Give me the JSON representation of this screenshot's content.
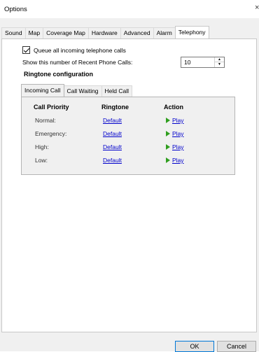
{
  "window": {
    "title": "Options",
    "close_glyph": "×"
  },
  "tabs": [
    "Sound",
    "Map",
    "Coverage Map",
    "Hardware",
    "Advanced",
    "Alarm",
    "Telephony"
  ],
  "active_tab": "Telephony",
  "queue_calls": {
    "label": "Queue all incoming telephone calls",
    "checked": true
  },
  "recent_calls": {
    "label": "Show this number of Recent Phone Calls:",
    "value": "10"
  },
  "ringtone_config": {
    "title": "Ringtone configuration"
  },
  "sub_tabs": [
    "Incoming Call",
    "Call Waiting",
    "Held Call"
  ],
  "active_sub_tab": "Incoming Call",
  "table": {
    "headers": {
      "priority": "Call Priority",
      "ringtone": "Ringtone",
      "action": "Action"
    },
    "rows": [
      {
        "priority": "Normal:",
        "ringtone": "Default",
        "action": "Play"
      },
      {
        "priority": "Emergency:",
        "ringtone": "Default",
        "action": "Play"
      },
      {
        "priority": "High:",
        "ringtone": "Default",
        "action": "Play"
      },
      {
        "priority": "Low:",
        "ringtone": "Default",
        "action": "Play"
      }
    ]
  },
  "buttons": {
    "ok": "OK",
    "cancel": "Cancel"
  },
  "colors": {
    "link": "#0000cc",
    "play_icon": "#2f9e1f",
    "dialog_bg": "#f0f0f0",
    "ok_border": "#0078d7"
  },
  "icons": {
    "close": "close-icon",
    "checkbox": "checkmark-icon",
    "play": "play-icon",
    "spin": "spinner-arrows-icon"
  }
}
